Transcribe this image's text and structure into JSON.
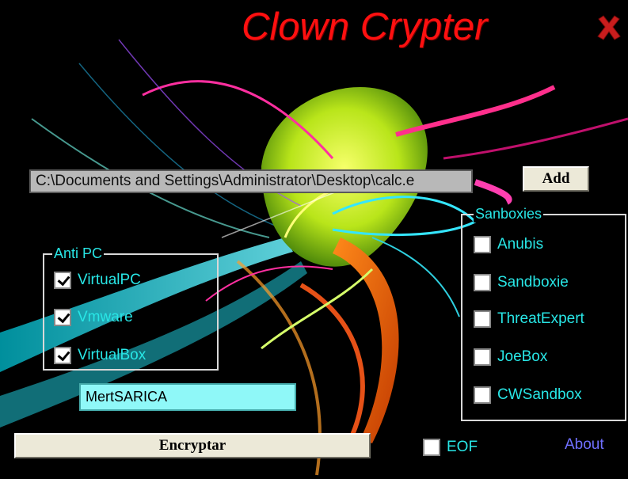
{
  "window": {
    "title": "Clown Crypter",
    "close_icon": "close-x-icon",
    "close_color": "#c81d1d"
  },
  "file": {
    "path_value": "C:\\Documents and Settings\\Administrator\\Desktop\\calc.e",
    "add_label": "Add"
  },
  "anti_pc": {
    "legend": "Anti PC",
    "items": [
      {
        "label": "VirtualPC",
        "checked": true
      },
      {
        "label": "Vmware",
        "checked": true
      },
      {
        "label": "VirtualBox",
        "checked": true
      }
    ]
  },
  "sandboxies": {
    "legend": "Sanboxies",
    "items": [
      {
        "label": "Anubis",
        "checked": false
      },
      {
        "label": "Sandboxie",
        "checked": false
      },
      {
        "label": "ThreatExpert",
        "checked": false
      },
      {
        "label": "JoeBox",
        "checked": false
      },
      {
        "label": "CWSandbox",
        "checked": false
      }
    ]
  },
  "name_field": {
    "value": "MertSARICA"
  },
  "encrypt": {
    "label": "Encryptar"
  },
  "eof": {
    "label": "EOF",
    "checked": false
  },
  "about": {
    "label": "About"
  },
  "colors": {
    "title": "#ff1010",
    "label_text": "#28e6e6",
    "link": "#7070ff",
    "name_bg": "#8ff8f8"
  }
}
